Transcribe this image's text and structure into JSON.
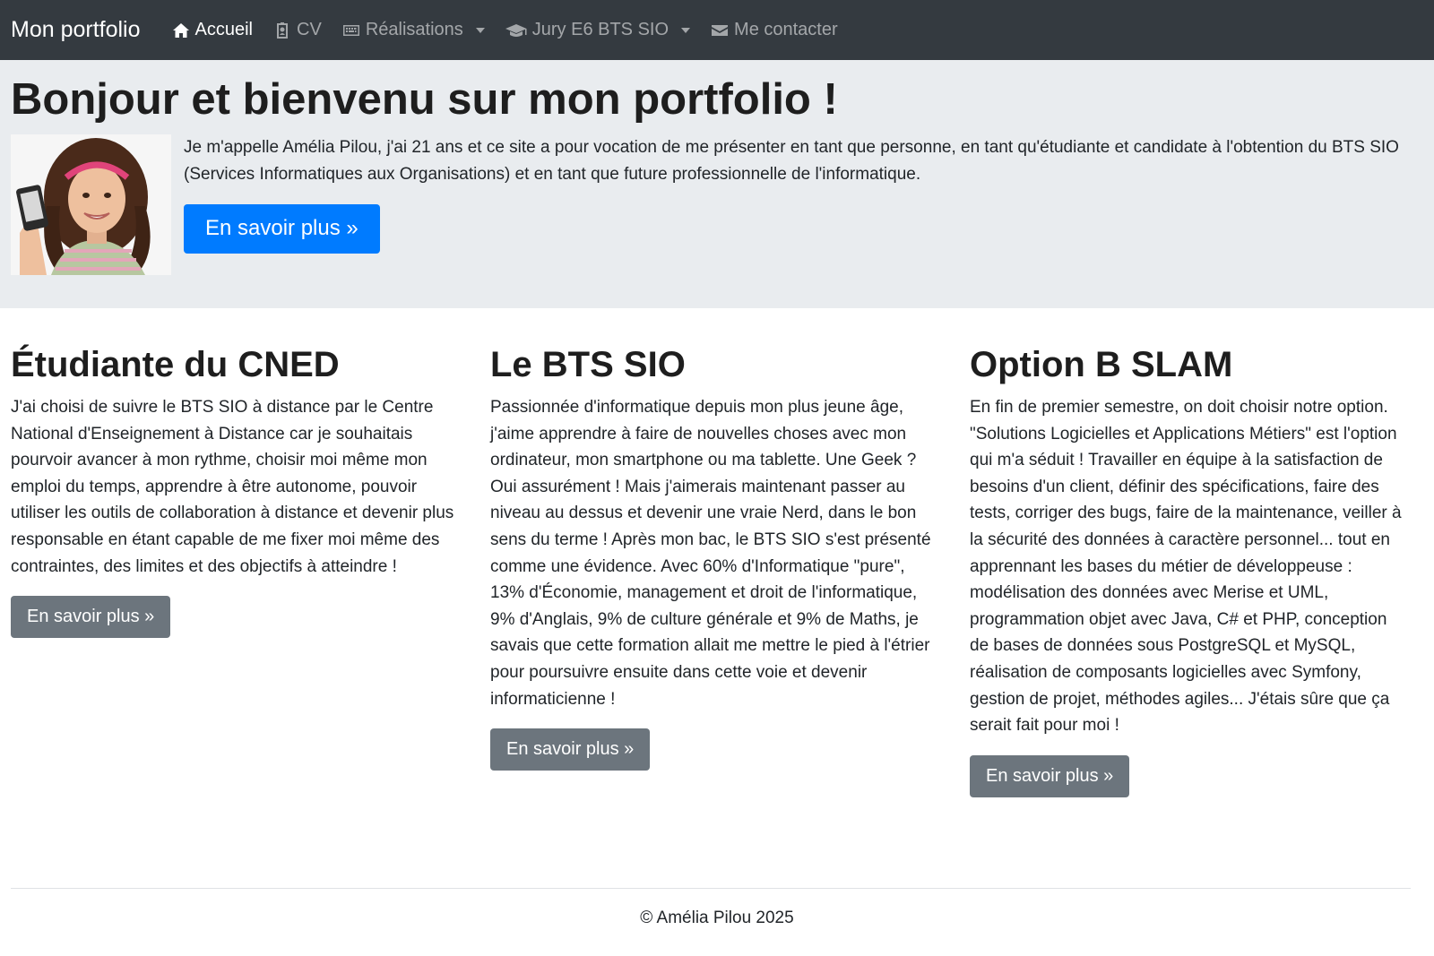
{
  "navbar": {
    "brand": "Mon portfolio",
    "items": [
      {
        "label": "Accueil",
        "icon": "home-icon",
        "active": true,
        "dropdown": false
      },
      {
        "label": "CV",
        "icon": "id-badge-icon",
        "active": false,
        "dropdown": false
      },
      {
        "label": "Réalisations",
        "icon": "keyboard-icon",
        "active": false,
        "dropdown": true
      },
      {
        "label": "Jury E6 BTS SIO",
        "icon": "graduation-cap-icon",
        "active": false,
        "dropdown": true
      },
      {
        "label": "Me contacter",
        "icon": "envelope-icon",
        "active": false,
        "dropdown": false
      }
    ]
  },
  "jumbotron": {
    "title": "Bonjour et bienvenu sur mon portfolio !",
    "intro": "Je m'appelle Amélia Pilou, j'ai 21 ans et ce site a pour vocation de me présenter en tant que personne, en tant qu'étudiante et candidate à l'obtention du BTS SIO (Services Informatiques aux Organisations) et en tant que future professionnelle de l'informatique.",
    "button_label": "En savoir plus »"
  },
  "columns": [
    {
      "heading": "Étudiante du CNED",
      "text": "J'ai choisi de suivre le BTS SIO à distance par le Centre National d'Enseignement à Distance car je souhaitais pourvoir avancer à mon rythme, choisir moi même mon emploi du temps, apprendre à être autonome, pouvoir utiliser les outils de collaboration à distance et devenir plus responsable en étant capable de me fixer moi même des contraintes, des limites et des objectifs à atteindre !",
      "button_label": "En savoir plus »"
    },
    {
      "heading": "Le BTS SIO",
      "text": "Passionnée d'informatique depuis mon plus jeune âge, j'aime apprendre à faire de nouvelles choses avec mon ordinateur, mon smartphone ou ma tablette. Une Geek ? Oui assurément ! Mais j'aimerais maintenant passer au niveau au dessus et devenir une vraie Nerd, dans le bon sens du terme ! Après mon bac, le BTS SIO s'est présenté comme une évidence. Avec 60% d'Informatique \"pure\", 13% d'Économie, management et droit de l'informatique, 9% d'Anglais, 9% de culture générale et 9% de Maths, je savais que cette formation allait me mettre le pied à l'étrier pour poursuivre ensuite dans cette voie et devenir informaticienne !",
      "button_label": "En savoir plus »"
    },
    {
      "heading": "Option B SLAM",
      "text": "En fin de premier semestre, on doit choisir notre option. \"Solutions Logicielles et Applications Métiers\" est l'option qui m'a séduit ! Travailler en équipe à la satisfaction de besoins d'un client, définir des spécifications, faire des tests, corriger des bugs, faire de la maintenance, veiller à la sécurité des données à caractère personnel... tout en apprennant les bases du métier de développeuse : modélisation des données avec Merise et UML, programmation objet avec Java, C# et PHP, conception de bases de données sous PostgreSQL et MySQL, réalisation de composants logicielles avec Symfony, gestion de projet, méthodes agiles... J'étais sûre que ça serait fait pour moi !",
      "button_label": "En savoir plus »"
    }
  ],
  "footer": {
    "text": "© Amélia Pilou 2025"
  },
  "colors": {
    "navbar_bg": "#343a40",
    "jumbotron_bg": "#e9ecef",
    "primary": "#007bff",
    "secondary": "#6c757d"
  }
}
